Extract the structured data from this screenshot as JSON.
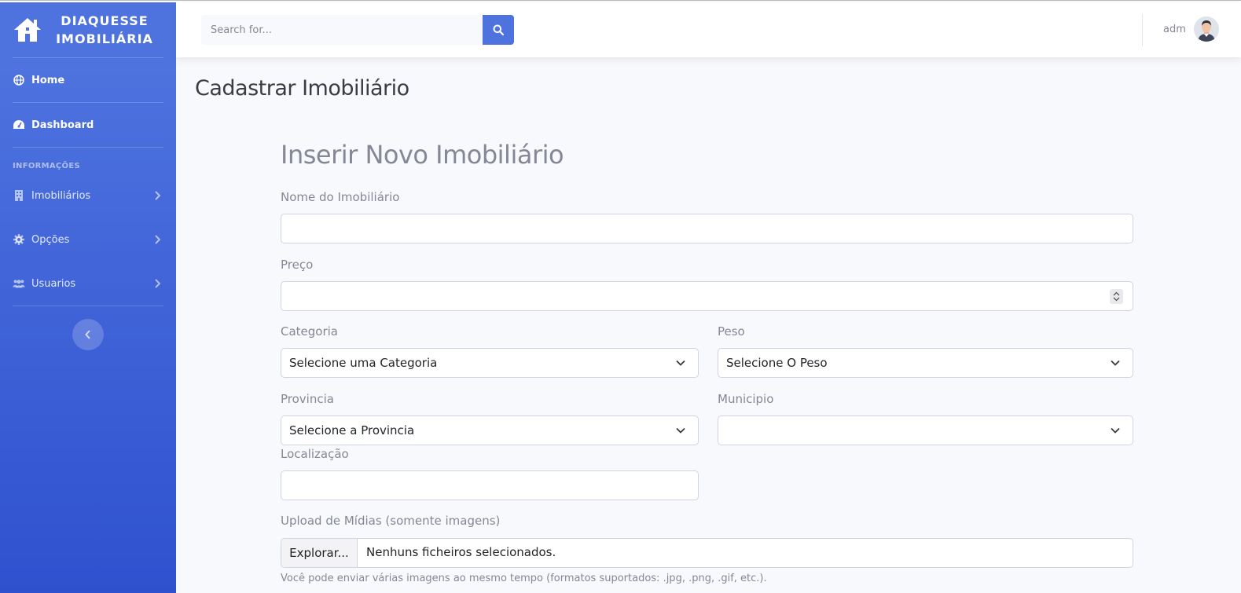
{
  "brand": {
    "line1": "DIAQUESSE",
    "line2": "IMOBILIÁRIA",
    "icon": "house-icon"
  },
  "sidebar": {
    "items_top": [
      {
        "label": "Home",
        "icon": "globe-icon"
      },
      {
        "label": "Dashboard",
        "icon": "tachometer-icon"
      }
    ],
    "heading": "INFORMAÇÕES",
    "items": [
      {
        "label": "Imobiliários",
        "icon": "building-icon"
      },
      {
        "label": "Opções",
        "icon": "gear-icon"
      },
      {
        "label": "Usuarios",
        "icon": "users-icon"
      }
    ]
  },
  "topbar": {
    "search_placeholder": "Search for...",
    "user_name": "adm"
  },
  "page": {
    "title": "Cadastrar Imobiliário",
    "form_title": "Inserir Novo Imobiliário"
  },
  "form": {
    "nome_label": "Nome do Imobiliário",
    "nome_value": "",
    "preco_label": "Preço",
    "preco_value": "",
    "categoria_label": "Categoria",
    "categoria_selected": "Selecione uma Categoria",
    "peso_label": "Peso",
    "peso_selected": "Selecione O Peso",
    "provincia_label": "Provincia",
    "provincia_selected": "Selecione a Provincia",
    "municipio_label": "Municipio",
    "municipio_selected": "",
    "localizacao_label": "Localização",
    "localizacao_value": "",
    "upload_label": "Upload de Mídias (somente imagens)",
    "upload_button": "Explorar...",
    "upload_status": "Nenhuns ficheiros selecionados.",
    "upload_help": "Você pode enviar várias imagens ao mesmo tempo (formatos suportados: .jpg, .png, .gif, etc.)."
  },
  "colors": {
    "primary": "#4e73df",
    "sidebar_bottom": "#2f51cf",
    "text_muted": "#858796",
    "page_bg": "#f8f9fc"
  }
}
